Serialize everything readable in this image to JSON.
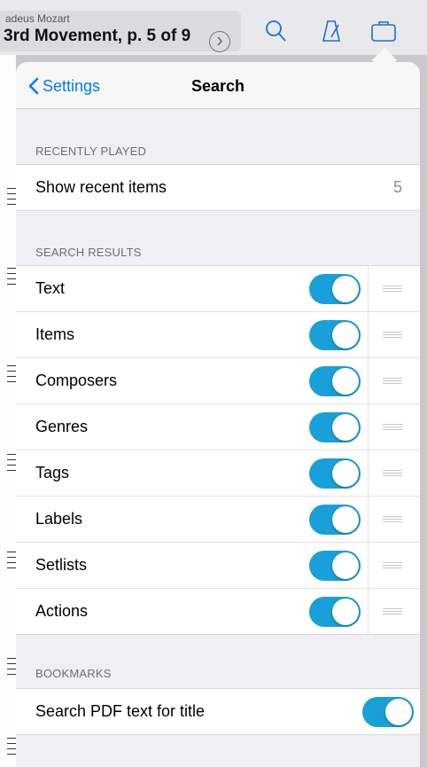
{
  "toolbar": {
    "composer": "adeus Mozart",
    "title": "3rd Movement, p. 5 of 9",
    "icons": [
      "chevron-right-circle-icon",
      "search-icon",
      "metronome-icon",
      "briefcase-icon"
    ]
  },
  "popover": {
    "back_label": "Settings",
    "title": "Search"
  },
  "sections": {
    "recently_played": {
      "header": "RECENTLY PLAYED",
      "rows": [
        {
          "label": "Show recent items",
          "value": "5"
        }
      ]
    },
    "search_results": {
      "header": "SEARCH RESULTS",
      "rows": [
        {
          "label": "Text",
          "on": true
        },
        {
          "label": "Items",
          "on": true
        },
        {
          "label": "Composers",
          "on": true
        },
        {
          "label": "Genres",
          "on": true
        },
        {
          "label": "Tags",
          "on": true
        },
        {
          "label": "Labels",
          "on": true
        },
        {
          "label": "Setlists",
          "on": true
        },
        {
          "label": "Actions",
          "on": true
        }
      ]
    },
    "bookmarks": {
      "header": "BOOKMARKS",
      "rows": [
        {
          "label": "Search PDF text for title",
          "on": true
        }
      ]
    }
  },
  "colors": {
    "accent": "#007aff",
    "toggle_on": "#1aa0d8",
    "background": "#efeff4"
  }
}
